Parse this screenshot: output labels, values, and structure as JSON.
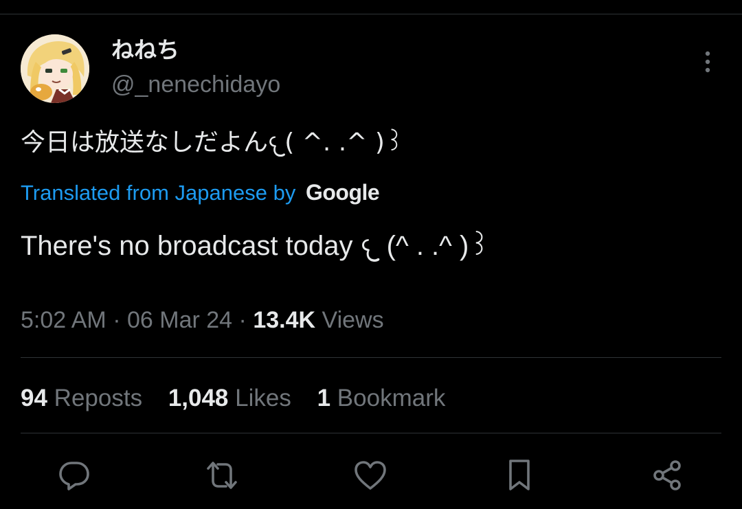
{
  "user": {
    "display_name": "ねねち",
    "handle": "@_nenechidayo"
  },
  "tweet": {
    "text": "今日は放送なしだよん‪𐔌( ^. .^ )꒱",
    "translated_label": "Translated from Japanese by",
    "translator_brand": "Google",
    "translation": "There's no broadcast today 𐔌 (^ . .^ )꒱"
  },
  "meta": {
    "time": "5:02 AM",
    "separator": "·",
    "date": "06 Mar 24",
    "views_count": "13.4K",
    "views_label": "Views"
  },
  "stats": {
    "reposts_count": "94",
    "reposts_label": "Reposts",
    "likes_count": "1,048",
    "likes_label": "Likes",
    "bookmarks_count": "1",
    "bookmarks_label": "Bookmark"
  },
  "icons": {
    "more": "more-vertical-icon",
    "reply": "reply-icon",
    "repost": "repost-icon",
    "like": "heart-icon",
    "bookmark": "bookmark-icon",
    "share": "share-icon"
  },
  "colors": {
    "background": "#000000",
    "text_primary": "#e7e9ea",
    "text_secondary": "#71767b",
    "link": "#1d9bf0",
    "divider": "#2f3336"
  }
}
